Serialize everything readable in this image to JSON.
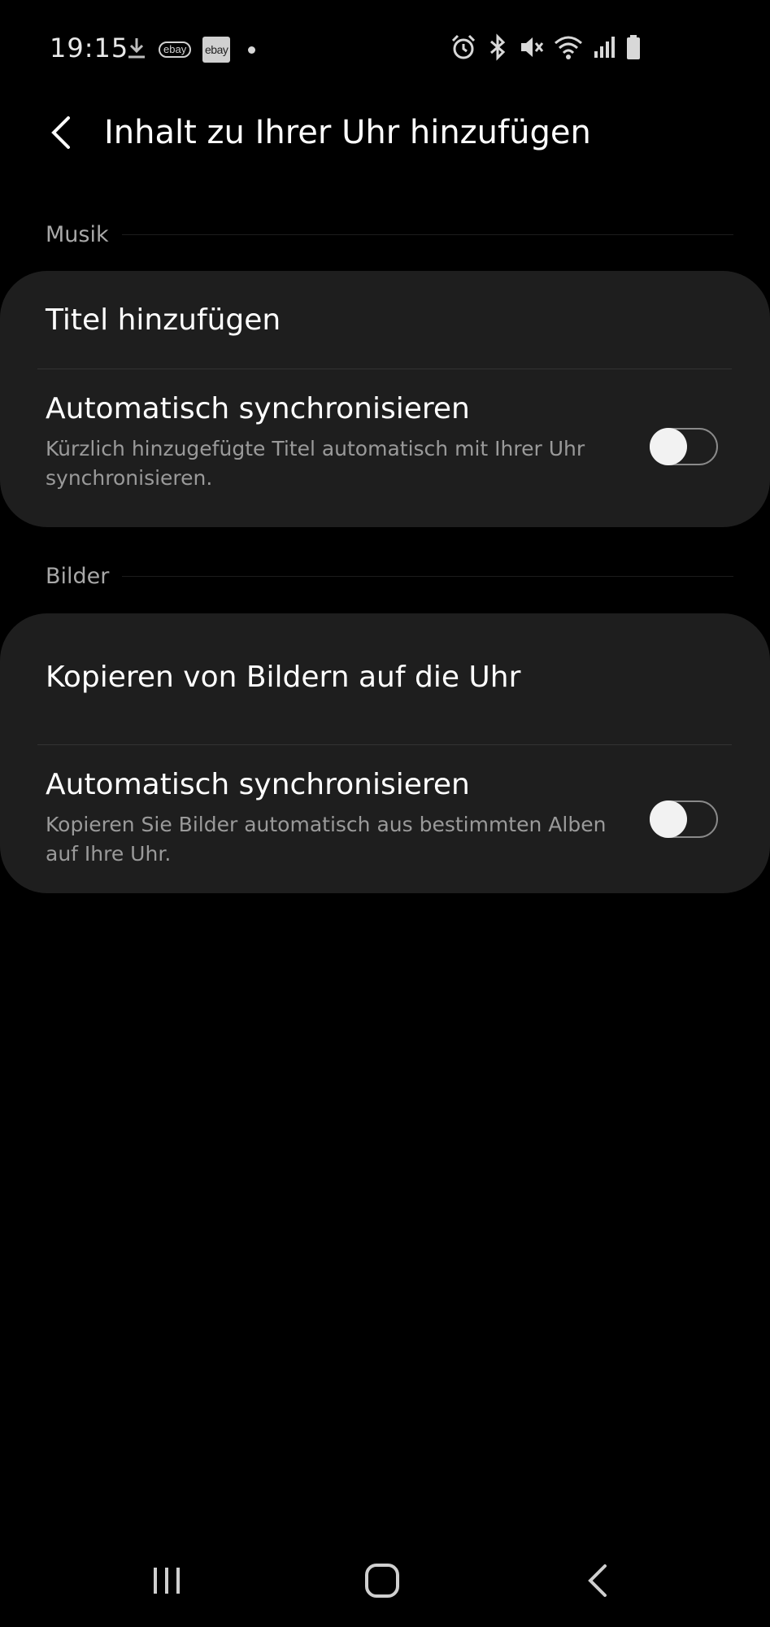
{
  "status_bar": {
    "time": "19:15",
    "notification_icons": [
      "download-icon",
      "ebay-kleinanzeigen-icon",
      "ebay-icon",
      "more-notifications-dot"
    ],
    "ebay_outline_text": "ebay",
    "ebay_filled_text": "ebay",
    "system_icons": [
      "alarm-icon",
      "bluetooth-icon",
      "vibrate-mute-icon",
      "wifi-icon",
      "signal-icon",
      "battery-icon"
    ]
  },
  "header": {
    "title": "Inhalt zu Ihrer Uhr hinzufügen"
  },
  "sections": {
    "music": {
      "label": "Musik",
      "add_tracks_label": "Titel hinzufügen",
      "auto_sync": {
        "title": "Automatisch synchronisieren",
        "subtitle": "Kürzlich hinzugefügte Titel automatisch mit Ihrer Uhr synchronisieren.",
        "enabled": false
      }
    },
    "images": {
      "label": "Bilder",
      "copy_images_label": "Kopieren von Bildern auf die Uhr",
      "auto_sync": {
        "title": "Automatisch synchronisieren",
        "subtitle": "Kopieren Sie Bilder automatisch aus bestimmten Alben auf Ihre Uhr.",
        "enabled": false
      }
    }
  },
  "nav_bar": {
    "items": [
      "recent-apps-icon",
      "home-icon",
      "back-icon"
    ]
  },
  "colors": {
    "background": "#000000",
    "card": "#1e1e1e",
    "primary_text": "#ffffff",
    "secondary_text": "#9a9a9a",
    "section_label": "#a8a8a8"
  }
}
